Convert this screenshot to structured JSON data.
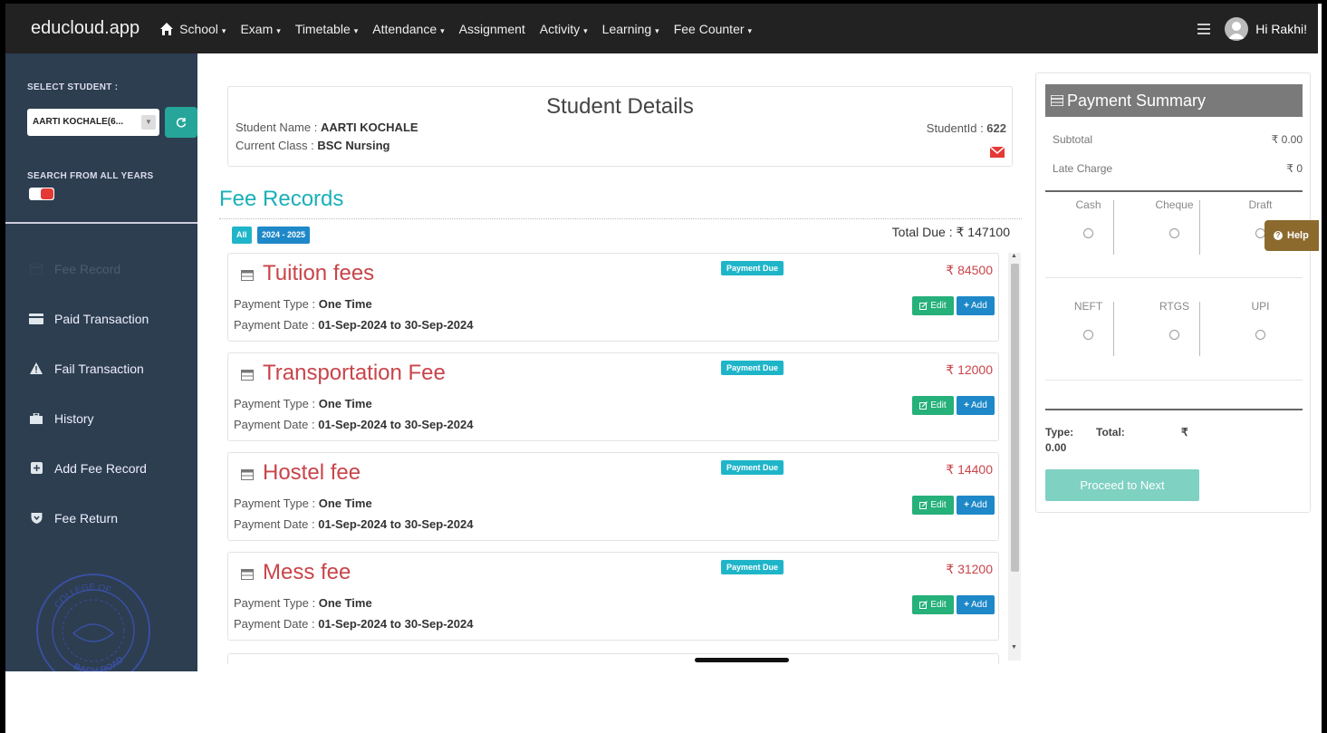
{
  "topbar": {
    "brand": "educloud.app",
    "nav": [
      {
        "label": "School",
        "caret": "▾"
      },
      {
        "label": "Exam",
        "caret": "▾"
      },
      {
        "label": "Timetable",
        "caret": "▾"
      },
      {
        "label": "Attendance",
        "caret": "▾"
      },
      {
        "label": "Assignment",
        "caret": ""
      },
      {
        "label": "Activity",
        "caret": "▾"
      },
      {
        "label": "Learning",
        "caret": "▾"
      },
      {
        "label": "Fee Counter",
        "caret": "▾"
      }
    ],
    "greeting": "Hi Rakhi!"
  },
  "sidebar": {
    "select_label": "SELECT STUDENT :",
    "selected_student": "AARTI KOCHALE(6...",
    "search_all_label": "SEARCH FROM ALL YEARS",
    "items": [
      {
        "label": "Fee Record",
        "icon": "table-icon"
      },
      {
        "label": "Paid Transaction",
        "icon": "card-icon"
      },
      {
        "label": "Fail Transaction",
        "icon": "warning-icon"
      },
      {
        "label": "History",
        "icon": "briefcase-icon"
      },
      {
        "label": "Add Fee Record",
        "icon": "plus-square-icon"
      },
      {
        "label": "Fee Return",
        "icon": "shield-icon"
      }
    ],
    "seal_text": {
      "top": "COLLEGE OF",
      "bottom": "BAGH ROAD"
    }
  },
  "details": {
    "title": "Student Details",
    "name_label": "Student Name : ",
    "name_value": "AARTI KOCHALE",
    "class_label": "Current Class : ",
    "class_value": "BSC Nursing",
    "id_label": "StudentId : ",
    "id_value": "622"
  },
  "fee_records": {
    "heading": "Fee Records",
    "filter_all": "All",
    "filter_year": "2024 - 2025",
    "total_due": "Total Due : ₹ 147100",
    "type_label": "Payment Type : ",
    "date_label": "Payment Date : ",
    "edit_label": "Edit",
    "add_label": "Add",
    "items": [
      {
        "name": "Tuition fees",
        "status": "Payment Due",
        "amount": "₹ 84500",
        "type": "One Time",
        "date": "01-Sep-2024 to 30-Sep-2024"
      },
      {
        "name": "Transportation Fee",
        "status": "Payment Due",
        "amount": "₹ 12000",
        "type": "One Time",
        "date": "01-Sep-2024 to 30-Sep-2024"
      },
      {
        "name": "Hostel fee",
        "status": "Payment Due",
        "amount": "₹ 14400",
        "type": "One Time",
        "date": "01-Sep-2024 to 30-Sep-2024"
      },
      {
        "name": "Mess fee",
        "status": "Payment Due",
        "amount": "₹ 31200",
        "type": "One Time",
        "date": "01-Sep-2024 to 30-Sep-2024"
      }
    ]
  },
  "summary": {
    "title": "Payment Summary",
    "subtotal_label": "Subtotal",
    "subtotal_value": "₹ 0.00",
    "late_label": "Late Charge",
    "late_value": "₹ 0",
    "methods_row1": [
      "Cash",
      "Cheque",
      "Draft"
    ],
    "methods_row2": [
      "NEFT",
      "RTGS",
      "UPI"
    ],
    "type_label": "Type:",
    "total_label": "Total:",
    "rupee": "₹",
    "total_value": "0.00",
    "proceed_label": "Proceed to Next"
  },
  "help": "Help",
  "colors": {
    "topbar": "#222222",
    "sidebar": "#2c3e50",
    "accent": "#1ab0b8",
    "due": "#c9444a"
  }
}
